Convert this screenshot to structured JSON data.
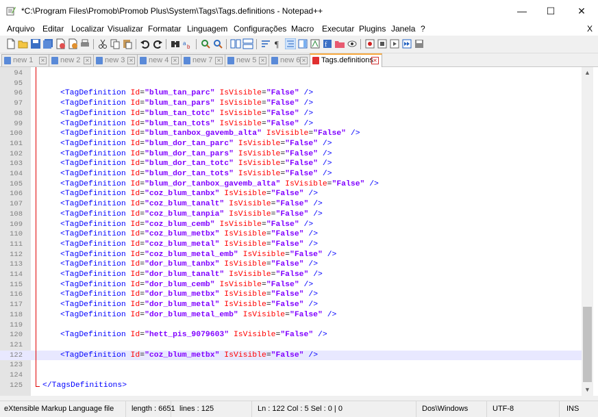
{
  "window": {
    "title": "*C:\\Program Files\\Promob\\Promob Plus\\System\\Tags\\Tags.definitions - Notepad++",
    "minimize_glyph": "—",
    "maximize_glyph": "☐",
    "close_glyph": "✕"
  },
  "menu": {
    "items": [
      "Arquivo",
      "Editar",
      "Localizar",
      "Visualizar",
      "Formatar",
      "Linguagem",
      "Configurações",
      "Macro",
      "Executar",
      "Plugins",
      "Janela",
      "?"
    ],
    "close_label": "X"
  },
  "toolbar": {
    "icons": [
      "new-file-icon",
      "open-file-icon",
      "save-icon",
      "save-all-icon",
      "close-icon",
      "close-all-icon",
      "print-icon",
      "cut-icon",
      "copy-icon",
      "paste-icon",
      "undo-icon",
      "redo-icon",
      "find-icon",
      "replace-icon",
      "zoom-in-icon",
      "zoom-out-icon",
      "sync-vertical-icon",
      "sync-horizontal-icon",
      "word-wrap-icon",
      "show-all-chars-icon",
      "indent-guide-icon",
      "doc-map-icon",
      "function-list-icon",
      "user-lang-icon",
      "folder-workspace-icon",
      "monitor-icon",
      "record-macro-icon",
      "stop-macro-icon",
      "play-macro-icon",
      "run-macro-multiple-icon",
      "save-macro-icon"
    ]
  },
  "tabs": [
    {
      "label": "new 1",
      "active": false
    },
    {
      "label": "new 2",
      "active": false
    },
    {
      "label": "new 3",
      "active": false
    },
    {
      "label": "new 4",
      "active": false
    },
    {
      "label": "new 7",
      "active": false
    },
    {
      "label": "new 5",
      "active": false
    },
    {
      "label": "new 6",
      "active": false
    },
    {
      "label": "Tags.definitions",
      "active": true
    }
  ],
  "editor": {
    "current_line": 122,
    "lines": [
      {
        "n": "94",
        "id": null,
        "text": ""
      },
      {
        "n": "95",
        "id": null,
        "text": ""
      },
      {
        "n": "96",
        "id": "blum_tan_parc"
      },
      {
        "n": "97",
        "id": "blum_tan_pars"
      },
      {
        "n": "98",
        "id": "blum_tan_totc"
      },
      {
        "n": "99",
        "id": "blum_tan_tots"
      },
      {
        "n": "100",
        "id": "blum_tanbox_gavemb_alta"
      },
      {
        "n": "101",
        "id": "blum_dor_tan_parc"
      },
      {
        "n": "102",
        "id": "blum_dor_tan_pars"
      },
      {
        "n": "103",
        "id": "blum_dor_tan_totc"
      },
      {
        "n": "104",
        "id": "blum_dor_tan_tots"
      },
      {
        "n": "105",
        "id": "blum_dor_tanbox_gavemb_alta"
      },
      {
        "n": "106",
        "id": "coz_blum_tanbx"
      },
      {
        "n": "107",
        "id": "coz_blum_tanalt"
      },
      {
        "n": "108",
        "id": "coz_blum_tanpia"
      },
      {
        "n": "109",
        "id": "coz_blum_cemb"
      },
      {
        "n": "110",
        "id": "coz_blum_metbx"
      },
      {
        "n": "111",
        "id": "coz_blum_metal"
      },
      {
        "n": "112",
        "id": "coz_blum_metal_emb"
      },
      {
        "n": "113",
        "id": "dor_blum_tanbx"
      },
      {
        "n": "114",
        "id": "dor_blum_tanalt"
      },
      {
        "n": "115",
        "id": "dor_blum_cemb"
      },
      {
        "n": "116",
        "id": "dor_blum_metbx"
      },
      {
        "n": "117",
        "id": "dor_blum_metal"
      },
      {
        "n": "118",
        "id": "dor_blum_metal_emb"
      },
      {
        "n": "119",
        "id": null,
        "text": ""
      },
      {
        "n": "120",
        "id": "hett_pis_9079603"
      },
      {
        "n": "121",
        "id": null,
        "text": ""
      },
      {
        "n": "122",
        "id": "coz_blum_metbx"
      },
      {
        "n": "123",
        "id": null,
        "text": ""
      },
      {
        "n": "124",
        "id": null,
        "text": ""
      },
      {
        "n": "125",
        "id": null,
        "text": "</TagsDefinitions>",
        "closing": true
      }
    ],
    "tag_open": "<TagDefinition",
    "attr_id": "Id",
    "attr_visible": "IsVisible",
    "visible_value": "\"False\"",
    "tag_close": "/>"
  },
  "status": {
    "language": "eXtensible Markup Language file",
    "length": "length : 6651",
    "lines": "lines : 125",
    "position": "Ln : 122    Col : 5    Sel : 0 | 0",
    "eol": "Dos\\Windows",
    "encoding": "UTF-8",
    "mode": "INS"
  },
  "colors": {
    "tag": "#0000ff",
    "attribute": "#ff0000",
    "string": "#8000ff",
    "current_line": "#e8e8ff",
    "fold_line": "#e00000",
    "active_tab_accent": "#f7a73c"
  }
}
